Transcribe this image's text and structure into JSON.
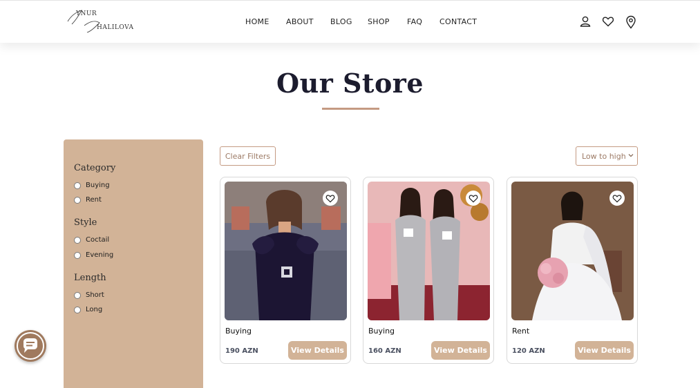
{
  "brand": {
    "logo_line1": "YNUR",
    "logo_line2": "HALILOVA"
  },
  "nav": {
    "items": [
      "HOME",
      "ABOUT",
      "BLOG",
      "SHOP",
      "FAQ",
      "CONTACT"
    ]
  },
  "header_icons": [
    "user-icon",
    "heart-icon",
    "location-pin-icon"
  ],
  "page": {
    "title": "Our Store"
  },
  "filters": {
    "groups": [
      {
        "title": "Category",
        "options": [
          "Buying",
          "Rent"
        ]
      },
      {
        "title": "Style",
        "options": [
          "Coctail",
          "Evening"
        ]
      },
      {
        "title": "Length",
        "options": [
          "Short",
          "Long"
        ]
      }
    ]
  },
  "toolbar": {
    "clear_label": "Clear Filters",
    "sort_value": "Low to high"
  },
  "products": [
    {
      "type": "Buying",
      "price": "190 AZN",
      "button": "View Details"
    },
    {
      "type": "Buying",
      "price": "160 AZN",
      "button": "View Details"
    },
    {
      "type": "Rent",
      "price": "120 AZN",
      "button": "View Details"
    }
  ],
  "colors": {
    "accent": "#d2b397",
    "accent_dark": "#c49a82",
    "chat_button": "#a07a5e"
  },
  "chat_icon": "chat-bubble-icon"
}
